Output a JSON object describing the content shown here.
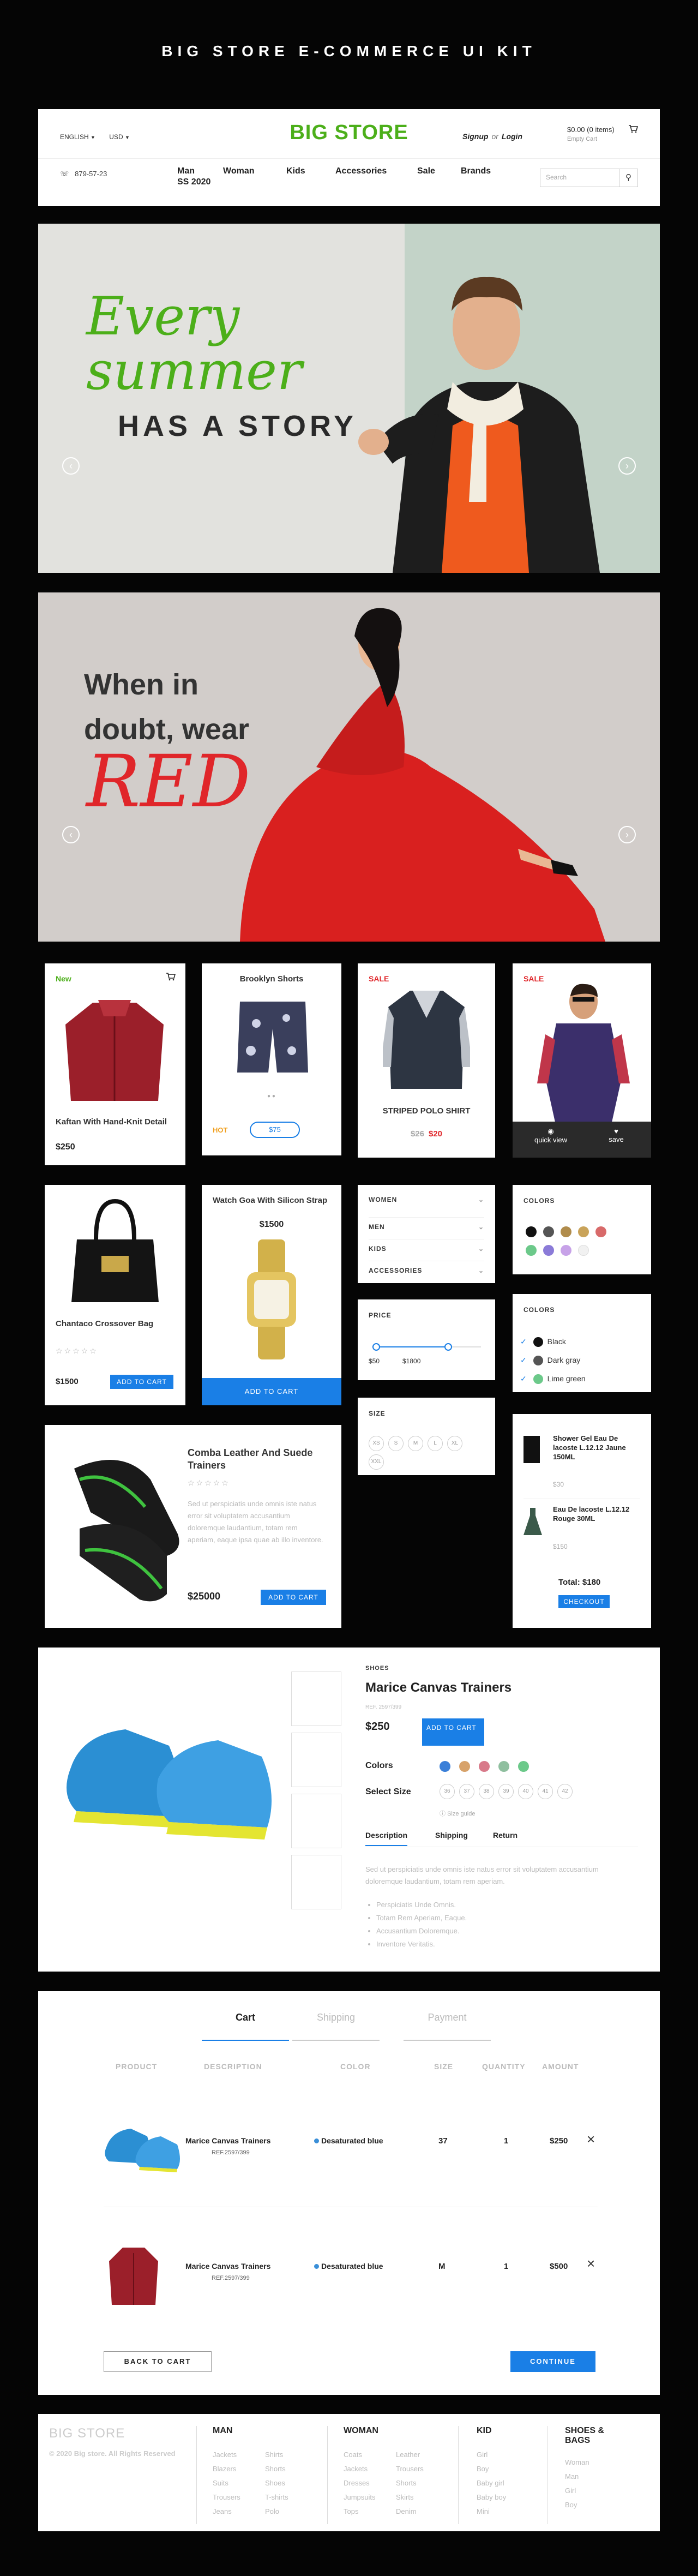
{
  "kit_title": "BIG STORE E-COMMERCE UI KIT",
  "header": {
    "language": "ENGLISH",
    "currency": "USD",
    "logo": "BIG STORE",
    "signup": "Signup",
    "or": "or",
    "login": "Login",
    "cart_total": "$0.00 (0 items)",
    "cart_empty": "Empty Cart",
    "phone": "879-57-23",
    "nav": [
      "Man",
      "Woman",
      "Kids",
      "Accessories",
      "Sale",
      "Brands"
    ],
    "nav_sub": "SS 2020",
    "search_placeholder": "Search"
  },
  "banner1": {
    "line1": "Every",
    "line2": "summer",
    "line3": "HAS A STORY"
  },
  "banner2": {
    "line1": "When in",
    "line2": "doubt, wear",
    "line3": "RED"
  },
  "products": {
    "kaftan": {
      "tag": "New",
      "name": "Kaftan With Hand-Knit Detail",
      "price": "$250"
    },
    "shorts": {
      "name": "Brooklyn Shorts",
      "tag": "HOT",
      "price": "$75"
    },
    "polo": {
      "tag": "SALE",
      "name": "STRIPED POLO SHIRT",
      "old_price": "$26",
      "price": "$20"
    },
    "shirt": {
      "tag": "SALE",
      "quick_view": "quick view",
      "save": "save"
    },
    "bag": {
      "name": "Chantaco Crossover Bag",
      "price": "$1500",
      "button": "ADD TO CART"
    },
    "watch": {
      "name": "Watch Goa With Silicon Strap",
      "price": "$1500",
      "button": "ADD TO CART"
    },
    "trainers": {
      "name": "Comba Leather And Suede Trainers",
      "desc": "Sed ut perspiciatis unde omnis iste natus error sit voluptatem accusantium doloremque laudantium, totam rem aperiam, eaque ipsa quae ab illo inventore.",
      "price": "$25000",
      "button": "ADD TO CART"
    }
  },
  "categories": [
    "WOMEN",
    "MEN",
    "KIDS",
    "ACCESSORIES"
  ],
  "filters": {
    "colors_title": "COLORS",
    "colors_title2": "COLORS",
    "color_list": [
      "Black",
      "Dark gray",
      "Lime green"
    ],
    "swatches": [
      "#111111",
      "#555555",
      "#b08c4c",
      "#c9a35a",
      "#d86a6a",
      "#6cc98a",
      "#8b7bd8",
      "#c7a2e8",
      "#f1f1f1"
    ],
    "price_title": "PRICE",
    "price_min": "$50",
    "price_max": "$1800",
    "price_low": 0.04,
    "price_high": 0.7,
    "size_title": "SIZE",
    "sizes": [
      "XS",
      "S",
      "M",
      "L",
      "XL",
      "XXL"
    ]
  },
  "mini_cart": {
    "items": [
      {
        "name": "Shower Gel Eau De lacoste L.12.12 Jaune 150ML",
        "price": "$30"
      },
      {
        "name": "Eau De lacoste L.12.12 Rouge 30ML",
        "price": "$150"
      }
    ],
    "total": "Total: $180",
    "checkout": "CHECKOUT"
  },
  "detail": {
    "category": "SHOES",
    "name": "Marice Canvas Trainers",
    "ref": "REF. 2597/399",
    "price": "$250",
    "button": "ADD TO CART",
    "colors_label": "Colors",
    "swatches": [
      "#3a7fd8",
      "#d7a26a",
      "#d87a8a",
      "#8fbf9f",
      "#6cc98a"
    ],
    "size_label": "Select Size",
    "sizes": [
      "36",
      "37",
      "38",
      "39",
      "40",
      "41",
      "42"
    ],
    "size_guide": "Size guide",
    "tabs": [
      "Description",
      "Shipping",
      "Return"
    ],
    "desc": "Sed ut perspiciatis unde omnis iste natus error sit voluptatem accusantium doloremque laudantium, totam rem aperiam.",
    "bullets": [
      "Perspiciatis Unde Omnis.",
      "Totam Rem Aperiam, Eaque.",
      "Accusantium Doloremque.",
      "Inventore Veritatis."
    ]
  },
  "cart": {
    "tabs": [
      "Cart",
      "Shipping",
      "Payment"
    ],
    "columns": [
      "PRODUCT",
      "DESCRIPTION",
      "COLOR",
      "SIZE",
      "QUANTITY",
      "AMOUNT"
    ],
    "rows": [
      {
        "name": "Marice Canvas Trainers",
        "ref": "REF.2597/399",
        "color": "Desaturated blue",
        "size": "37",
        "qty": "1",
        "amount": "$250"
      },
      {
        "name": "Marice Canvas Trainers",
        "ref": "REF.2597/399",
        "color": "Desaturated blue",
        "size": "M",
        "qty": "1",
        "amount": "$500"
      }
    ],
    "back": "BACK TO CART",
    "continue": "CONTINUE"
  },
  "footer": {
    "brand": "BIG STORE",
    "copyright": "© 2020 Big store. All Rights Reserved",
    "man_title": "MAN",
    "man_a": [
      "Jackets",
      "Blazers",
      "Suits",
      "Trousers",
      "Jeans"
    ],
    "man_b": [
      "Shirts",
      "Shorts",
      "Shoes",
      "T-shirts",
      "Polo"
    ],
    "woman_title": "WOMAN",
    "woman_a": [
      "Coats",
      "Jackets",
      "Dresses",
      "Jumpsuits",
      "Tops"
    ],
    "woman_b": [
      "Leather",
      "Trousers",
      "Shorts",
      "Skirts",
      "Denim"
    ],
    "kid_title": "KID",
    "kid": [
      "Girl",
      "Boy",
      "Baby girl",
      "Baby boy",
      "Mini"
    ],
    "shoes_title": "SHOES & BAGS",
    "shoes": [
      "Woman",
      "Man",
      "Girl",
      "Boy"
    ]
  }
}
